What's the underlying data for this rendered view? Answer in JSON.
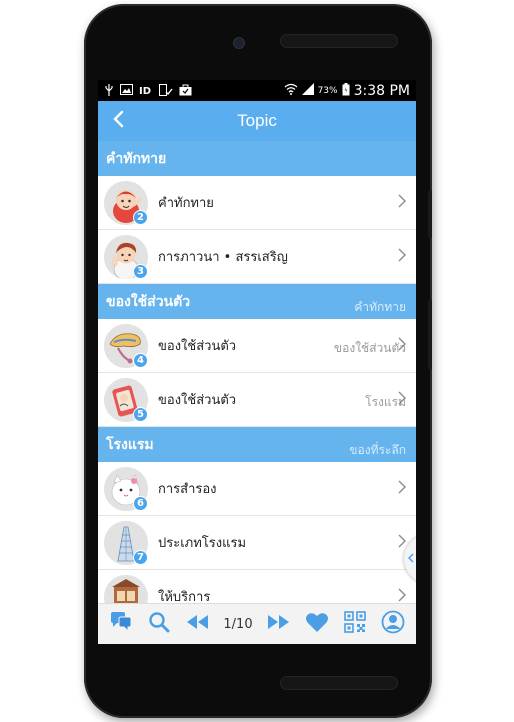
{
  "status": {
    "battery_pct": "73%",
    "time": "3:38 PM"
  },
  "header": {
    "title": "Topic"
  },
  "sections": [
    {
      "title": "คำทักทาย",
      "items": [
        {
          "num": "2",
          "label": "คำทักทาย"
        },
        {
          "num": "3",
          "label": "การภาวนา • สรรเสริญ"
        }
      ]
    },
    {
      "title": "ของใช้ส่วนตัว",
      "ghost": "คำทักทาย",
      "items": [
        {
          "num": "4",
          "label": "ของใช้ส่วนตัว",
          "ghost": "ของใช้ส่วนตัว"
        },
        {
          "num": "5",
          "label": "ของใช้ส่วนตัว",
          "ghost": "โรงแรม"
        }
      ]
    },
    {
      "title": "โรงแรม",
      "ghost": "ของที่ระลึก",
      "items": [
        {
          "num": "6",
          "label": "การสำรอง"
        },
        {
          "num": "7",
          "label": "ประเภทโรงแรม"
        },
        {
          "num": "",
          "label": "ให้บริการ"
        }
      ]
    }
  ],
  "pager": {
    "page": "1/10"
  },
  "colors": {
    "primary": "#5aaef0",
    "section": "#66b4ee",
    "icon": "#4aa5ec"
  },
  "icons": [
    "chat-icon",
    "search-icon",
    "rewind-icon",
    "fast-forward-icon",
    "heart-icon",
    "qr-code-icon",
    "profile-icon"
  ]
}
